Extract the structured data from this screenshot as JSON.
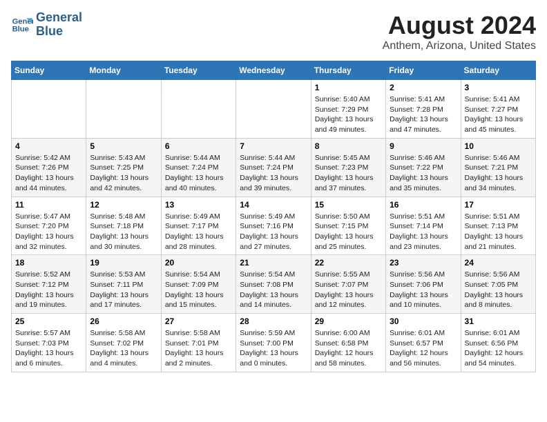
{
  "logo": {
    "line1": "General",
    "line2": "Blue"
  },
  "title": "August 2024",
  "subtitle": "Anthem, Arizona, United States",
  "header": {
    "accent_color": "#2e75b6"
  },
  "days_of_week": [
    "Sunday",
    "Monday",
    "Tuesday",
    "Wednesday",
    "Thursday",
    "Friday",
    "Saturday"
  ],
  "weeks": [
    [
      {
        "day": "",
        "info": ""
      },
      {
        "day": "",
        "info": ""
      },
      {
        "day": "",
        "info": ""
      },
      {
        "day": "",
        "info": ""
      },
      {
        "day": "1",
        "info": "Sunrise: 5:40 AM\nSunset: 7:29 PM\nDaylight: 13 hours\nand 49 minutes."
      },
      {
        "day": "2",
        "info": "Sunrise: 5:41 AM\nSunset: 7:28 PM\nDaylight: 13 hours\nand 47 minutes."
      },
      {
        "day": "3",
        "info": "Sunrise: 5:41 AM\nSunset: 7:27 PM\nDaylight: 13 hours\nand 45 minutes."
      }
    ],
    [
      {
        "day": "4",
        "info": "Sunrise: 5:42 AM\nSunset: 7:26 PM\nDaylight: 13 hours\nand 44 minutes."
      },
      {
        "day": "5",
        "info": "Sunrise: 5:43 AM\nSunset: 7:25 PM\nDaylight: 13 hours\nand 42 minutes."
      },
      {
        "day": "6",
        "info": "Sunrise: 5:44 AM\nSunset: 7:24 PM\nDaylight: 13 hours\nand 40 minutes."
      },
      {
        "day": "7",
        "info": "Sunrise: 5:44 AM\nSunset: 7:24 PM\nDaylight: 13 hours\nand 39 minutes."
      },
      {
        "day": "8",
        "info": "Sunrise: 5:45 AM\nSunset: 7:23 PM\nDaylight: 13 hours\nand 37 minutes."
      },
      {
        "day": "9",
        "info": "Sunrise: 5:46 AM\nSunset: 7:22 PM\nDaylight: 13 hours\nand 35 minutes."
      },
      {
        "day": "10",
        "info": "Sunrise: 5:46 AM\nSunset: 7:21 PM\nDaylight: 13 hours\nand 34 minutes."
      }
    ],
    [
      {
        "day": "11",
        "info": "Sunrise: 5:47 AM\nSunset: 7:20 PM\nDaylight: 13 hours\nand 32 minutes."
      },
      {
        "day": "12",
        "info": "Sunrise: 5:48 AM\nSunset: 7:18 PM\nDaylight: 13 hours\nand 30 minutes."
      },
      {
        "day": "13",
        "info": "Sunrise: 5:49 AM\nSunset: 7:17 PM\nDaylight: 13 hours\nand 28 minutes."
      },
      {
        "day": "14",
        "info": "Sunrise: 5:49 AM\nSunset: 7:16 PM\nDaylight: 13 hours\nand 27 minutes."
      },
      {
        "day": "15",
        "info": "Sunrise: 5:50 AM\nSunset: 7:15 PM\nDaylight: 13 hours\nand 25 minutes."
      },
      {
        "day": "16",
        "info": "Sunrise: 5:51 AM\nSunset: 7:14 PM\nDaylight: 13 hours\nand 23 minutes."
      },
      {
        "day": "17",
        "info": "Sunrise: 5:51 AM\nSunset: 7:13 PM\nDaylight: 13 hours\nand 21 minutes."
      }
    ],
    [
      {
        "day": "18",
        "info": "Sunrise: 5:52 AM\nSunset: 7:12 PM\nDaylight: 13 hours\nand 19 minutes."
      },
      {
        "day": "19",
        "info": "Sunrise: 5:53 AM\nSunset: 7:11 PM\nDaylight: 13 hours\nand 17 minutes."
      },
      {
        "day": "20",
        "info": "Sunrise: 5:54 AM\nSunset: 7:09 PM\nDaylight: 13 hours\nand 15 minutes."
      },
      {
        "day": "21",
        "info": "Sunrise: 5:54 AM\nSunset: 7:08 PM\nDaylight: 13 hours\nand 14 minutes."
      },
      {
        "day": "22",
        "info": "Sunrise: 5:55 AM\nSunset: 7:07 PM\nDaylight: 13 hours\nand 12 minutes."
      },
      {
        "day": "23",
        "info": "Sunrise: 5:56 AM\nSunset: 7:06 PM\nDaylight: 13 hours\nand 10 minutes."
      },
      {
        "day": "24",
        "info": "Sunrise: 5:56 AM\nSunset: 7:05 PM\nDaylight: 13 hours\nand 8 minutes."
      }
    ],
    [
      {
        "day": "25",
        "info": "Sunrise: 5:57 AM\nSunset: 7:03 PM\nDaylight: 13 hours\nand 6 minutes."
      },
      {
        "day": "26",
        "info": "Sunrise: 5:58 AM\nSunset: 7:02 PM\nDaylight: 13 hours\nand 4 minutes."
      },
      {
        "day": "27",
        "info": "Sunrise: 5:58 AM\nSunset: 7:01 PM\nDaylight: 13 hours\nand 2 minutes."
      },
      {
        "day": "28",
        "info": "Sunrise: 5:59 AM\nSunset: 7:00 PM\nDaylight: 13 hours\nand 0 minutes."
      },
      {
        "day": "29",
        "info": "Sunrise: 6:00 AM\nSunset: 6:58 PM\nDaylight: 12 hours\nand 58 minutes."
      },
      {
        "day": "30",
        "info": "Sunrise: 6:01 AM\nSunset: 6:57 PM\nDaylight: 12 hours\nand 56 minutes."
      },
      {
        "day": "31",
        "info": "Sunrise: 6:01 AM\nSunset: 6:56 PM\nDaylight: 12 hours\nand 54 minutes."
      }
    ]
  ]
}
